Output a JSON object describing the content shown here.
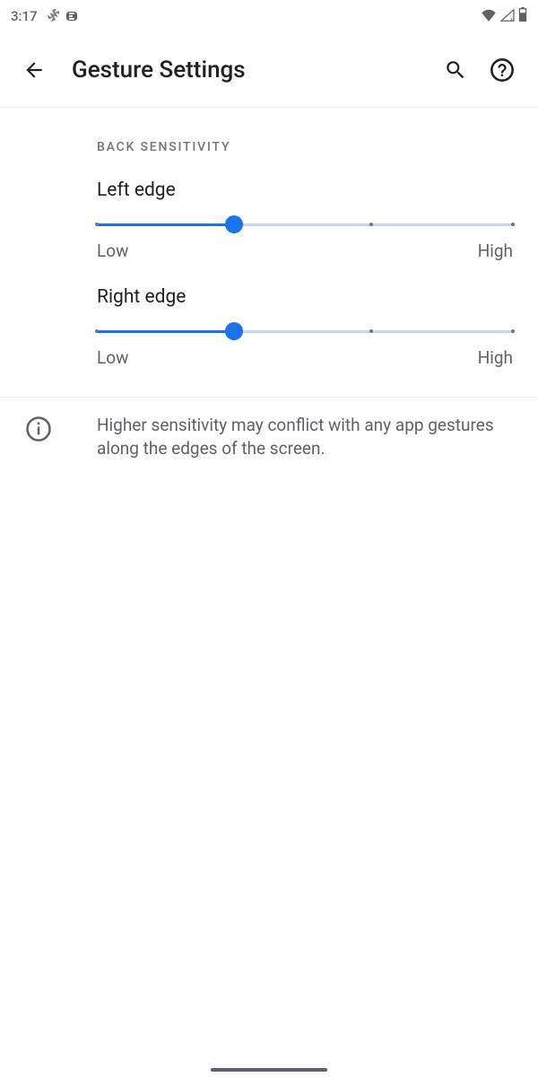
{
  "statusbar": {
    "time": "3:17"
  },
  "appbar": {
    "title": "Gesture Settings"
  },
  "section": {
    "header": "BACK SENSITIVITY",
    "sliders": [
      {
        "id": "left-edge",
        "label": "Left edge",
        "lowLabel": "Low",
        "highLabel": "High",
        "position_pct": 33,
        "ticks_pct": [
          0,
          33,
          66,
          100
        ]
      },
      {
        "id": "right-edge",
        "label": "Right edge",
        "lowLabel": "Low",
        "highLabel": "High",
        "position_pct": 33,
        "ticks_pct": [
          0,
          33,
          66,
          100
        ]
      }
    ]
  },
  "info": {
    "text": "Higher sensitivity may conflict with any app gestures along the edges of the screen."
  },
  "colors": {
    "accent": "#1a73e8",
    "text_primary": "#202124",
    "text_secondary": "#5f6368"
  }
}
